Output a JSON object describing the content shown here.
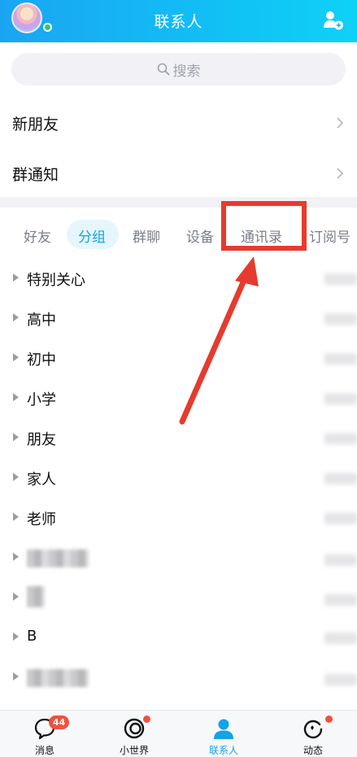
{
  "header": {
    "title": "联系人",
    "add_friend_icon": "add-friend-icon"
  },
  "search": {
    "placeholder": "搜索",
    "icon": "search-icon"
  },
  "rows": [
    {
      "label": "新朋友"
    },
    {
      "label": "群通知"
    }
  ],
  "tabs": [
    {
      "label": "好友",
      "active": false
    },
    {
      "label": "分组",
      "active": true
    },
    {
      "label": "群聊",
      "active": false
    },
    {
      "label": "设备",
      "active": false
    },
    {
      "label": "通讯录",
      "active": false
    },
    {
      "label": "订阅号",
      "active": false
    }
  ],
  "annotation": {
    "color": "#e53b2f",
    "target": "通讯录"
  },
  "groups": [
    {
      "label": "特别关心"
    },
    {
      "label": "高中"
    },
    {
      "label": "初中"
    },
    {
      "label": "小学"
    },
    {
      "label": "朋友"
    },
    {
      "label": "家人"
    },
    {
      "label": "老师"
    },
    {
      "label": ""
    },
    {
      "label": ""
    },
    {
      "label": "B"
    },
    {
      "label": ""
    }
  ],
  "bottom_nav": [
    {
      "label": "消息",
      "icon": "chat-bubble-icon",
      "badge": "44"
    },
    {
      "label": "小世界",
      "icon": "world-icon",
      "dot": true
    },
    {
      "label": "联系人",
      "icon": "contacts-icon",
      "active": true
    },
    {
      "label": "动态",
      "icon": "refresh-star-icon",
      "dot": true
    }
  ],
  "colors": {
    "accent": "#15a3e8",
    "header_start": "#1aa5f2",
    "header_end": "#0fd1f6",
    "badge": "#f0513d"
  }
}
